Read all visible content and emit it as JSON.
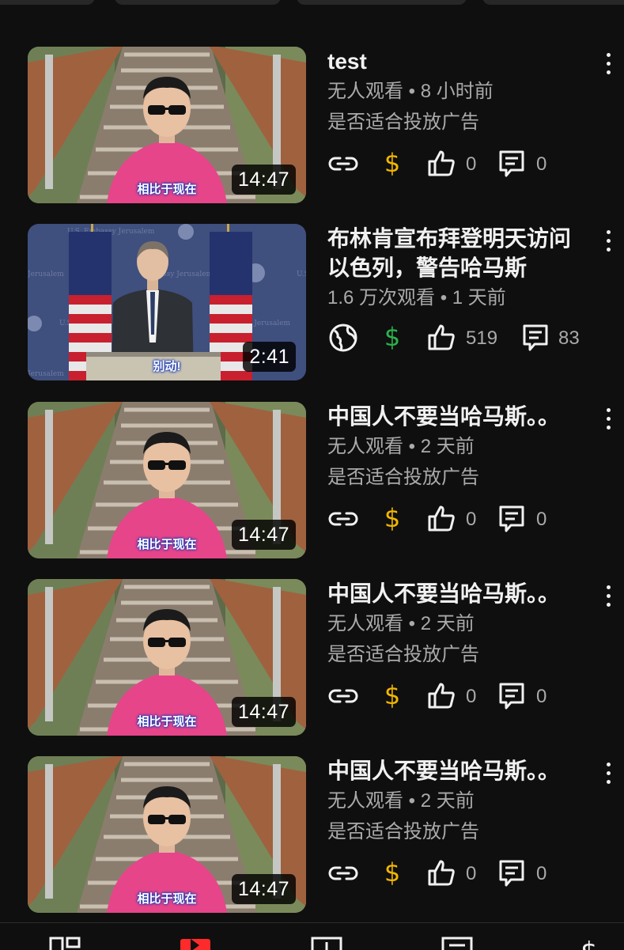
{
  "colors": {
    "background": "#0f0f0f",
    "text_primary": "#f1f1f1",
    "text_secondary": "#aaaaaa",
    "monetization_off": "#f2b600",
    "monetization_on": "#2bb24c",
    "caption_outline": "#1b3cb8"
  },
  "videos": [
    {
      "title": "test",
      "meta1": "无人观看 • 8 小时前",
      "meta2": "是否适合投放广告",
      "duration": "14:47",
      "caption": "相比于现在",
      "thumbnail": "stairs-man",
      "visibility_icon": "link-icon",
      "monetization": "off",
      "likes": "0",
      "comments": "0"
    },
    {
      "title": "布林肯宣布拜登明天访问以色列，警告哈马斯",
      "meta1": "1.6 万次观看 • 1 天前",
      "meta2": "",
      "duration": "2:41",
      "caption": "别动!",
      "thumbnail": "podium-flags",
      "visibility_icon": "globe-icon",
      "monetization": "on",
      "likes": "519",
      "comments": "83"
    },
    {
      "title": "中国人不要当哈马斯。。",
      "meta1": "无人观看 • 2 天前",
      "meta2": "是否适合投放广告",
      "duration": "14:47",
      "caption": "相比于现在",
      "thumbnail": "stairs-man",
      "visibility_icon": "link-icon",
      "monetization": "off",
      "likes": "0",
      "comments": "0"
    },
    {
      "title": "中国人不要当哈马斯。。",
      "meta1": "无人观看 • 2 天前",
      "meta2": "是否适合投放广告",
      "duration": "14:47",
      "caption": "相比于现在",
      "thumbnail": "stairs-man",
      "visibility_icon": "link-icon",
      "monetization": "off",
      "likes": "0",
      "comments": "0"
    },
    {
      "title": "中国人不要当哈马斯。。",
      "meta1": "无人观看 • 2 天前",
      "meta2": "是否适合投放广告",
      "duration": "14:47",
      "caption": "相比于现在",
      "thumbnail": "stairs-man",
      "visibility_icon": "link-icon",
      "monetization": "off",
      "likes": "0",
      "comments": "0"
    }
  ],
  "bottom_nav": [
    "dashboard-icon",
    "content-icon",
    "analytics-icon",
    "comments-icon",
    "earn-icon"
  ]
}
